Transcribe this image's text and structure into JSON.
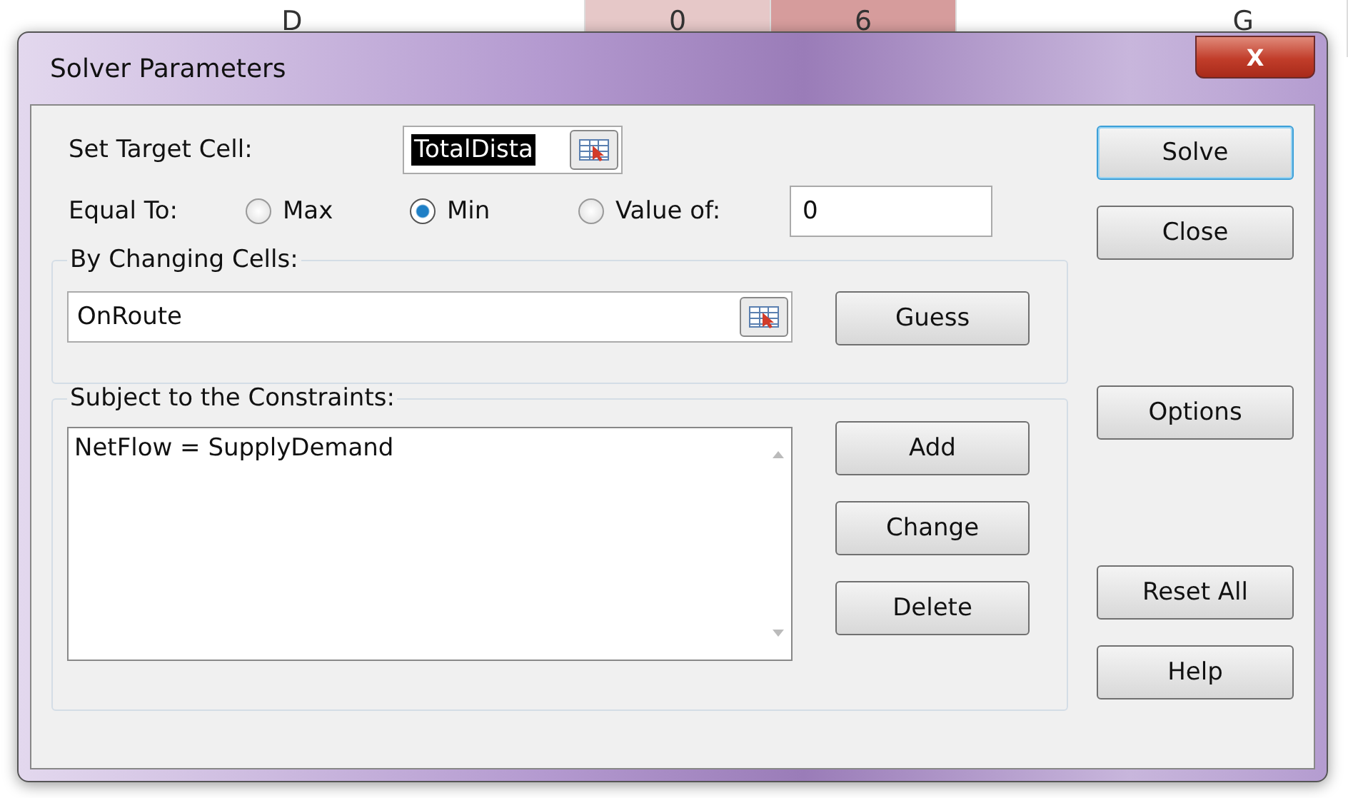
{
  "background_sheet": {
    "column_headers": [
      {
        "label": "D"
      },
      {
        "label": "0"
      },
      {
        "label": "6"
      },
      {
        "label": "G"
      }
    ]
  },
  "window": {
    "title": "Solver Parameters",
    "close_label": "X"
  },
  "target_cell": {
    "label": "Set Target Cell:",
    "value": "TotalDista",
    "text_selected": true
  },
  "equal_to": {
    "label": "Equal To:",
    "options": [
      {
        "label": "Max",
        "selected": false
      },
      {
        "label": "Min",
        "selected": true
      },
      {
        "label": "Value of:",
        "selected": false
      }
    ],
    "value": "0"
  },
  "changing_cells": {
    "label": "By Changing Cells:",
    "value": "OnRoute",
    "button": "Guess"
  },
  "constraints": {
    "label": "Subject to the Constraints:",
    "items": [
      "NetFlow = SupplyDemand"
    ],
    "buttons": [
      "Add",
      "Change",
      "Delete"
    ]
  },
  "side_buttons": [
    {
      "label": "Solve",
      "kind": "default"
    },
    {
      "label": "Close",
      "kind": "normal"
    },
    {
      "label": "Options",
      "kind": "normal"
    },
    {
      "label": "Reset All",
      "kind": "normal"
    },
    {
      "label": "Help",
      "kind": "normal"
    }
  ]
}
